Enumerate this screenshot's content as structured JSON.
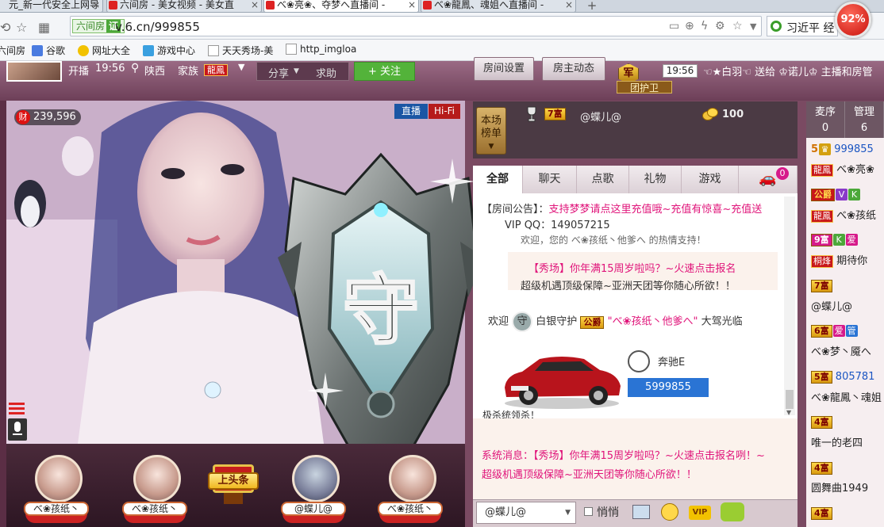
{
  "browser": {
    "tabs": [
      {
        "label": "元_新一代安全上网导",
        "active": false
      },
      {
        "label": "六间房 - 美女视频 - 美女直",
        "active": false
      },
      {
        "label": "べ❀亮❀、夺梦へ直播间 -",
        "active": true
      },
      {
        "label": "べ❀龍鳳、魂姐へ直播间 -",
        "active": false
      }
    ],
    "newtab_symbol": "+",
    "url_badge_text": "六间房",
    "url_badge_mark": "证",
    "url": "v.6.cn/999855",
    "search_text": "习近平 经",
    "cpu_usage": "92%",
    "bookmarks": [
      {
        "label": "六间房",
        "color": "#d22"
      },
      {
        "label": "谷歌",
        "color": "#4a7be0"
      },
      {
        "label": "网址大全",
        "color": "#f2c200"
      },
      {
        "label": "游戏中心",
        "color": "#3aa0e0"
      },
      {
        "label": "天天秀场-美",
        "color": "#ffffff"
      },
      {
        "label": "http_imgloa",
        "color": "#ffffff"
      }
    ]
  },
  "room": {
    "status": "开播",
    "time": "19:56",
    "location": "陕西",
    "family_label": "家族",
    "family_badge": "龍鳳",
    "share": "分享",
    "report": "求助",
    "follow": "+ 关注",
    "room_settings": "房间设置",
    "host_news": "房主动态",
    "guard_emblem": "军",
    "guard_group": "团护卫",
    "ticker_time": "19:56",
    "ticker_text": "☜★白羽☜ 送给 ♔诺儿♔ 主播和房管"
  },
  "video": {
    "wealth_icon": "财",
    "wealth": "239,596",
    "live_badge": "直播",
    "hifi_badge": "Hi-Fi",
    "guard_char": "守"
  },
  "guards": [
    {
      "name": "べ❀孩纸丶"
    },
    {
      "name": "べ❀孩纸丶"
    },
    {
      "name": "@蝶儿@"
    },
    {
      "name": "べ❀孩纸丶"
    }
  ],
  "headline": "上头条",
  "rank": {
    "tab_label_1": "本场",
    "tab_label_2": "榜单",
    "level": "7富",
    "name": "@蝶儿@",
    "coins": "100"
  },
  "chat_tabs": [
    {
      "label": "全部",
      "active": true
    },
    {
      "label": "聊天",
      "active": false
    },
    {
      "label": "点歌",
      "active": false
    },
    {
      "label": "礼物",
      "active": false
    },
    {
      "label": "游戏",
      "active": false
    }
  ],
  "car_count": "0",
  "chat": {
    "notice_label": "【房间公告】：",
    "notice_text": "支持梦梦请点这里充值哦~充值有惊喜~充值送",
    "notice_qq": "VIP QQ：149057215",
    "thanks_line": "欢迎，您的 べ❀孩纸丶他爹へ 的热情支持！",
    "sys_prefix": "系统消息：",
    "sys1_a": "【秀场】你年满15周岁啦吗？~火速点击报名",
    "sys1_b": "超级机遇顶级保障~亚洲天团等你随心所欲！！",
    "welcome_prefix": "欢迎",
    "welcome_guard": "白银守护",
    "welcome_badge": "公爵",
    "welcome_user": "\"べ❀孩纸丶他爹へ\"",
    "welcome_suffix": "大驾光临",
    "car_name": "奔驰E",
    "car_number": "5999855",
    "game_line": "极杀统领杀！",
    "sys2_a": "【秀场】你年满15周岁啦吗？~火速点击报名咧！~",
    "sys2_b": "超级机遇顶级保障~亚洲天团等你随心所欲！！"
  },
  "chat_input": {
    "target": "@蝶儿@",
    "private_label": "悄悄"
  },
  "right_panel": {
    "tab1": "麦序",
    "tab1_count": "0",
    "tab2": "管理",
    "tab2_count": "6",
    "rows": [
      {
        "top": "5",
        "badge": "999855",
        "family": "龍鳳",
        "name": "べ❀亮❀"
      },
      {
        "badge": "公爵",
        "family": "龍鳳",
        "name": "べ❀孩纸"
      },
      {
        "badge": "9富",
        "family": "桐烽",
        "name": "期待你"
      },
      {
        "badge": "7富",
        "name": "@蝶儿@"
      },
      {
        "badge": "6富",
        "name": "べ❀梦丶魇へ"
      },
      {
        "badge": "5富",
        "id": "805781",
        "name": "べ❀龍鳳丶魂姐"
      },
      {
        "badge": "4富",
        "name": "唯一的老四"
      },
      {
        "badge": "4富",
        "name": "圆舞曲1949"
      },
      {
        "badge": "4富",
        "name": ""
      }
    ]
  }
}
